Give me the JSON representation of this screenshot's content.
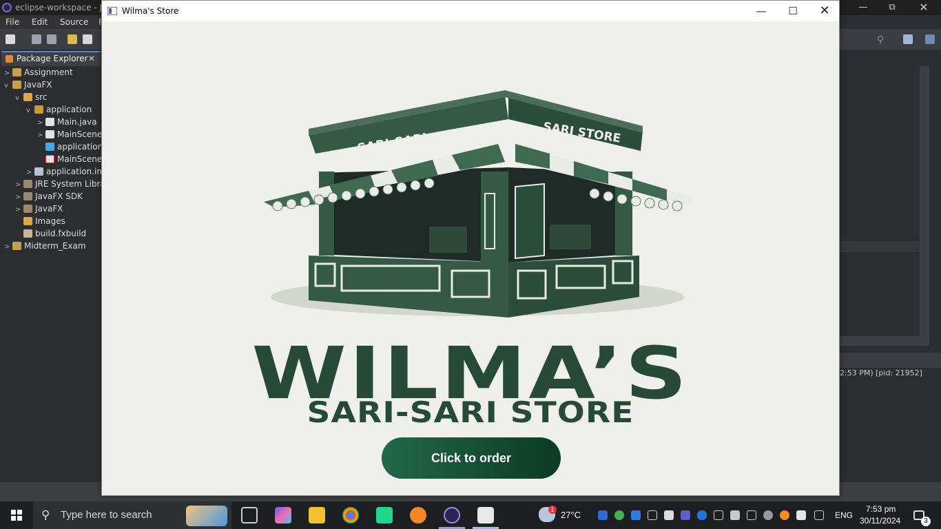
{
  "eclipse": {
    "window_title": "eclipse-workspace - Jav",
    "menu": [
      "File",
      "Edit",
      "Source",
      "R"
    ],
    "package_explorer": {
      "tab_label": "Package Explorer",
      "items": [
        {
          "label": "Assignment",
          "chevron": ">"
        },
        {
          "label": "JavaFX",
          "chevron": "v"
        },
        {
          "label": "src",
          "chevron": "v"
        },
        {
          "label": "application",
          "chevron": "v"
        },
        {
          "label": "Main.java",
          "chevron": ">"
        },
        {
          "label": "MainScene",
          "chevron": ">"
        },
        {
          "label": "application",
          "chevron": ""
        },
        {
          "label": "MainScene",
          "chevron": ""
        },
        {
          "label": "application.im",
          "chevron": ">"
        },
        {
          "label": "JRE System Librar",
          "chevron": ">"
        },
        {
          "label": "JavaFX SDK",
          "chevron": ">"
        },
        {
          "label": "JavaFX",
          "chevron": ">"
        },
        {
          "label": "Images",
          "chevron": ""
        },
        {
          "label": "build.fxbuild",
          "chevron": ""
        },
        {
          "label": "Midterm_Exam",
          "chevron": ">"
        }
      ]
    },
    "console_text": "2:53 PM) [pid: 21952]"
  },
  "app": {
    "window_title": "Wilma's Store",
    "sign_left": "SARI-SARI",
    "sign_right": "SARI STORE",
    "brand_title": "WILMA’S",
    "brand_subtitle": "SARI-SARI STORE",
    "order_button": "Click to order"
  },
  "taskbar": {
    "search_placeholder": "Type here to search",
    "weather": "27°C",
    "language": "ENG",
    "time": "7:53 pm",
    "date": "30/11/2024",
    "notifications": "3",
    "weather_badge": "1"
  },
  "colors": {
    "brand_green": "#274a37",
    "button_gradient_start": "#23674a",
    "button_gradient_end": "#0b3a25"
  }
}
